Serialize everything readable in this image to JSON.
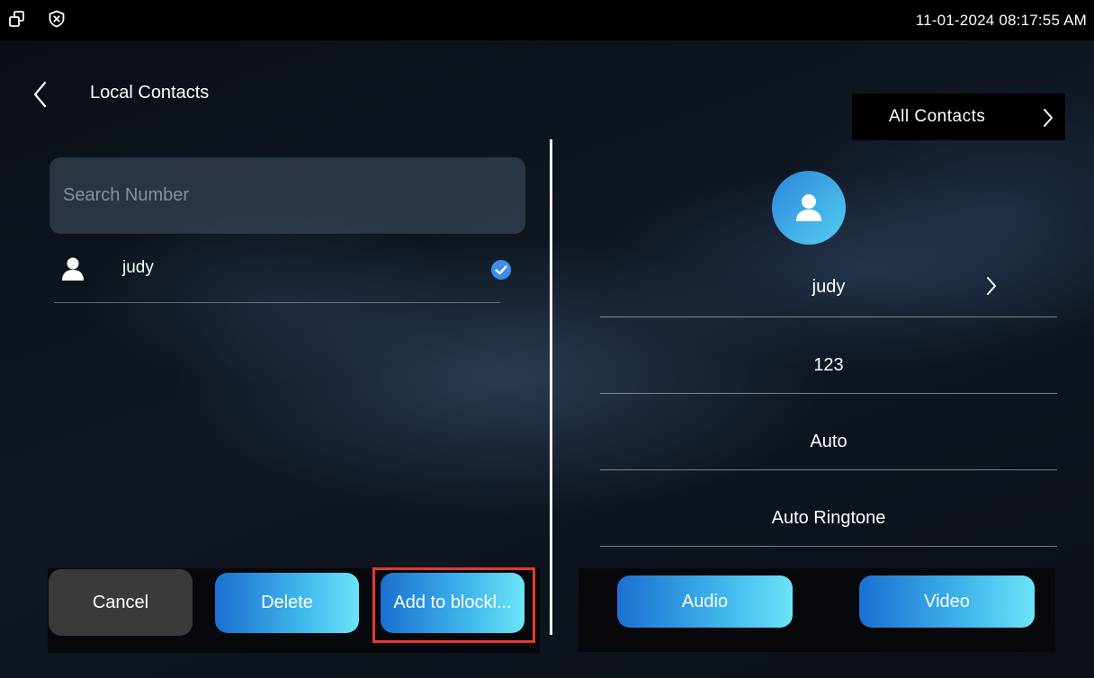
{
  "status_bar": {
    "icons": [
      "window-restore-icon",
      "shield-x-icon"
    ],
    "datetime": "11-01-2024 08:17:55 AM"
  },
  "header": {
    "title": "Local Contacts",
    "filter_label": "All Contacts"
  },
  "search": {
    "placeholder": "Search Number"
  },
  "contacts": [
    {
      "name": "judy",
      "selected": true
    }
  ],
  "detail": {
    "name": "judy",
    "number": "123",
    "mode": "Auto",
    "ringtone": "Auto Ringtone"
  },
  "actions": {
    "cancel": "Cancel",
    "delete": "Delete",
    "add_to_blocklist": "Add to blockl..."
  },
  "call_actions": {
    "audio": "Audio",
    "video": "Video"
  },
  "colors": {
    "accent_start": "#1b6fd0",
    "accent_end": "#6ce4f8",
    "highlight": "#e23a2c",
    "check": "#3b8fe8"
  }
}
